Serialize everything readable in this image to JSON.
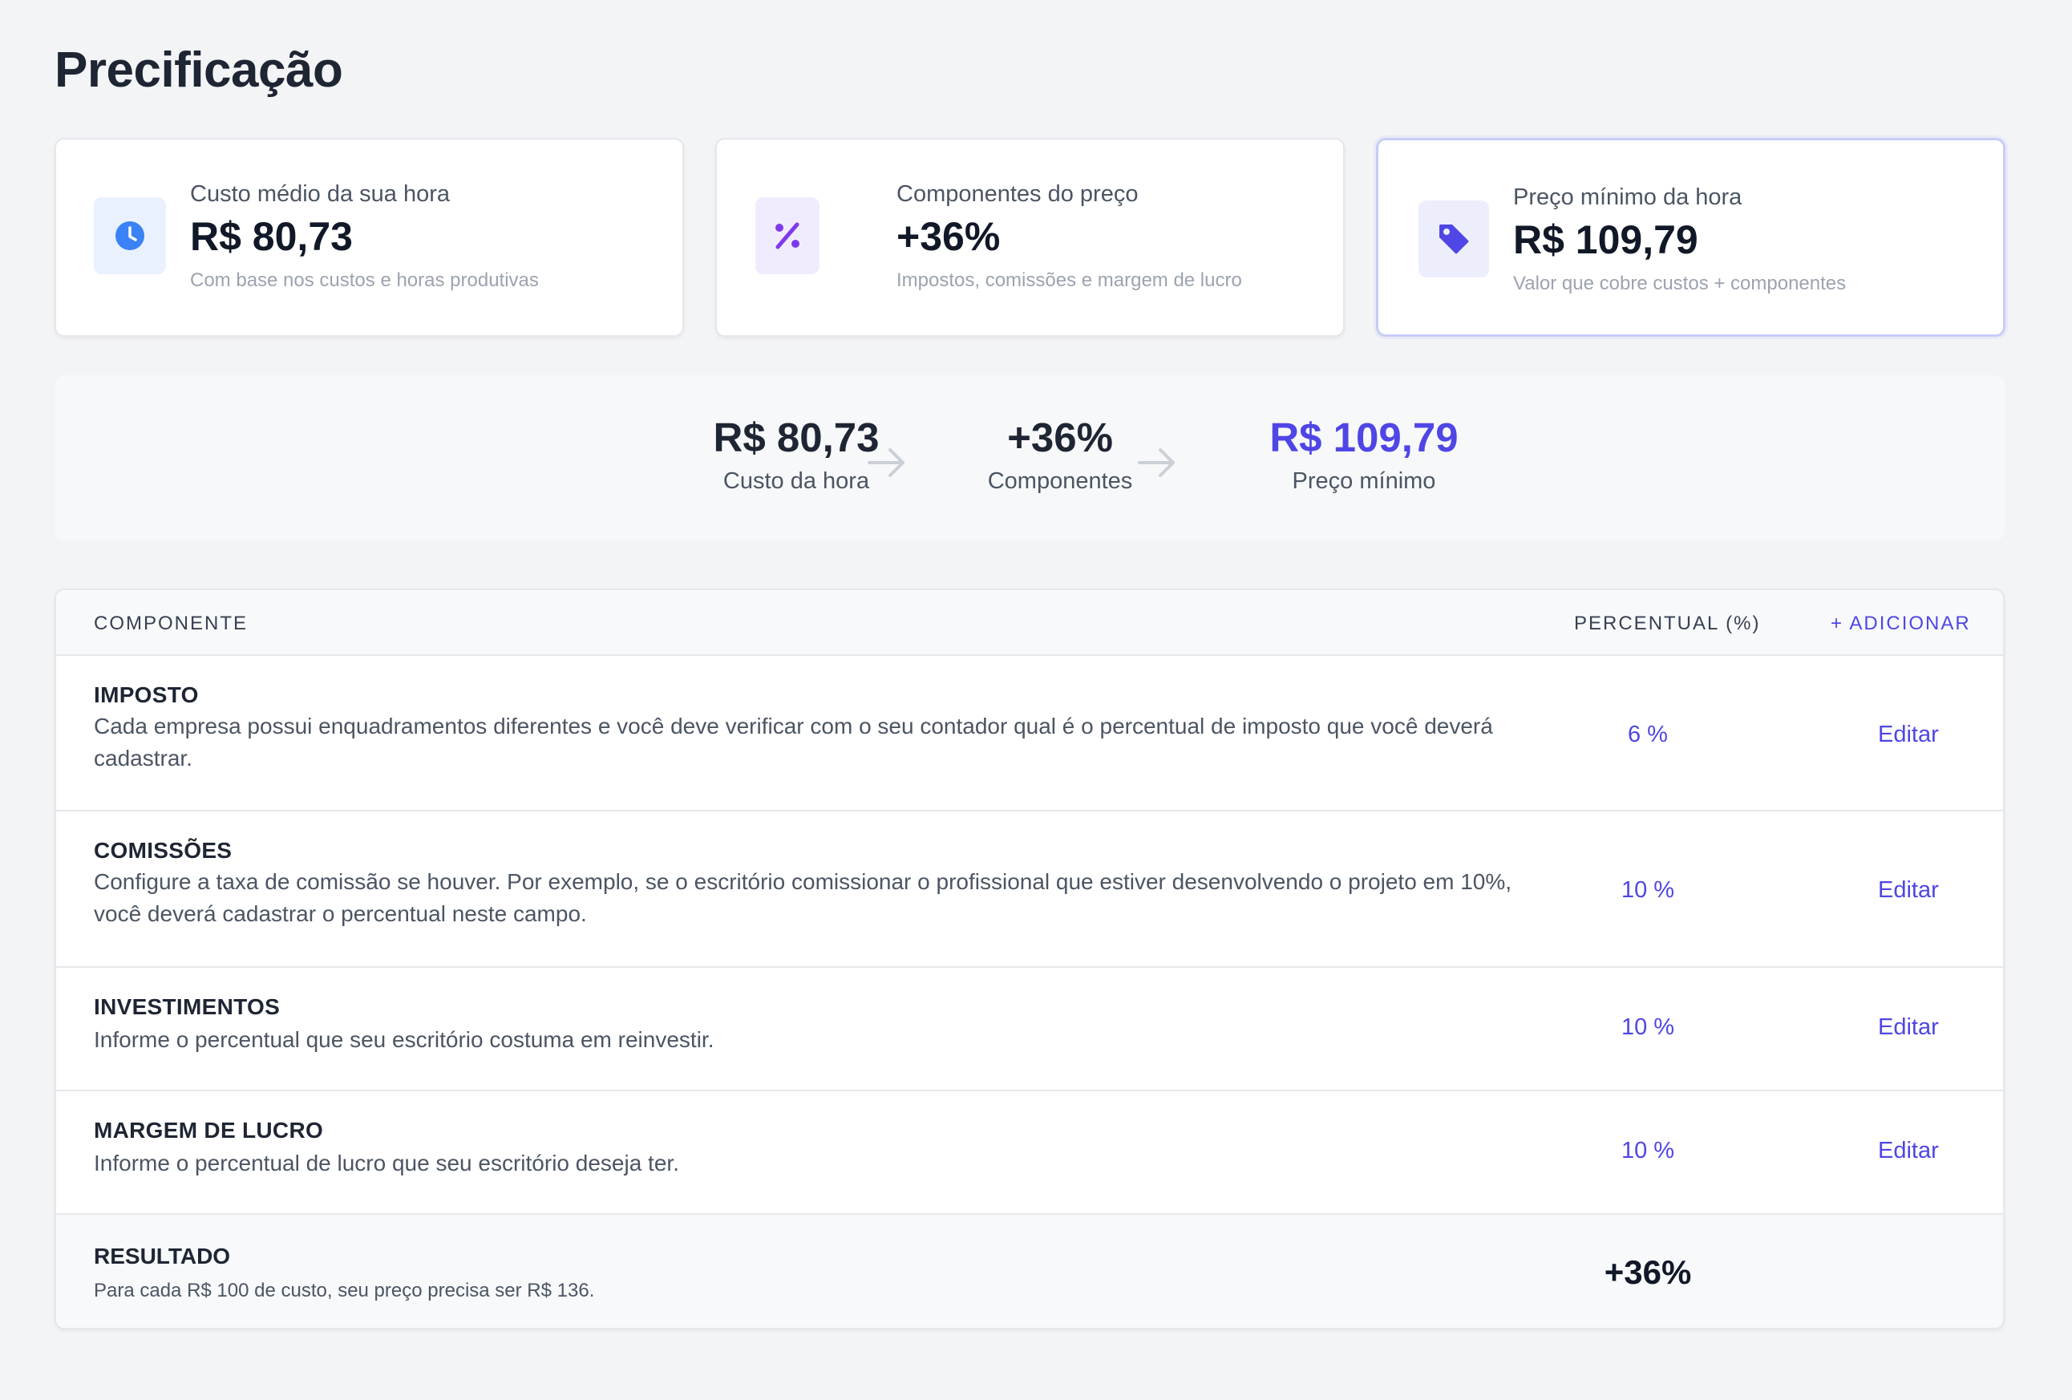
{
  "page": {
    "title": "Precificação"
  },
  "cards": [
    {
      "label": "Custo médio da sua hora",
      "value": "R$ 80,73",
      "sub": "Com base nos custos e horas produtivas",
      "icon": "clock-icon",
      "accent": "#3b82f6"
    },
    {
      "label": "Componentes do preço",
      "value": "+36%",
      "sub": "Impostos, comissões e margem de lucro",
      "icon": "percent-icon",
      "accent": "#7c3aed"
    },
    {
      "label": "Preço mínimo da hora",
      "value": "R$ 109,79",
      "sub": "Valor que cobre custos + componentes",
      "icon": "tag-icon",
      "accent": "#4f46e5"
    }
  ],
  "flow": [
    {
      "value": "R$ 80,73",
      "label": "Custo da hora"
    },
    {
      "value": "+36%",
      "label": "Componentes"
    },
    {
      "value": "R$ 109,79",
      "label": "Preço mínimo"
    }
  ],
  "table": {
    "headers": {
      "component": "COMPONENTE",
      "percent": "PERCENTUAL (%)",
      "add": "+ ADICIONAR"
    },
    "rows": [
      {
        "name": "IMPOSTO",
        "description": "Cada empresa possui enquadramentos diferentes e você deve verificar com o seu contador qual é o percentual de imposto que você deverá cadastrar.",
        "percent": "6 %",
        "action": "Editar"
      },
      {
        "name": "COMISSÕES",
        "description": "Configure a taxa de comissão se houver. Por exemplo, se o escritório comissionar o profissional que estiver desenvolvendo o projeto em 10%, você deverá cadastrar o percentual neste campo.",
        "percent": "10 %",
        "action": "Editar"
      },
      {
        "name": "INVESTIMENTOS",
        "description": "Informe o percentual que seu escritório costuma em reinvestir.",
        "percent": "10 %",
        "action": "Editar"
      },
      {
        "name": "MARGEM DE LUCRO",
        "description": "Informe o percentual de lucro que seu escritório deseja ter.",
        "percent": "10 %",
        "action": "Editar"
      }
    ],
    "result": {
      "name": "RESULTADO",
      "description": "Para cada R$ 100 de custo, seu preço precisa ser R$ 136.",
      "value": "+36%"
    }
  },
  "colors": {
    "accent": "#4f46e5",
    "background": "#f3f4f6"
  }
}
